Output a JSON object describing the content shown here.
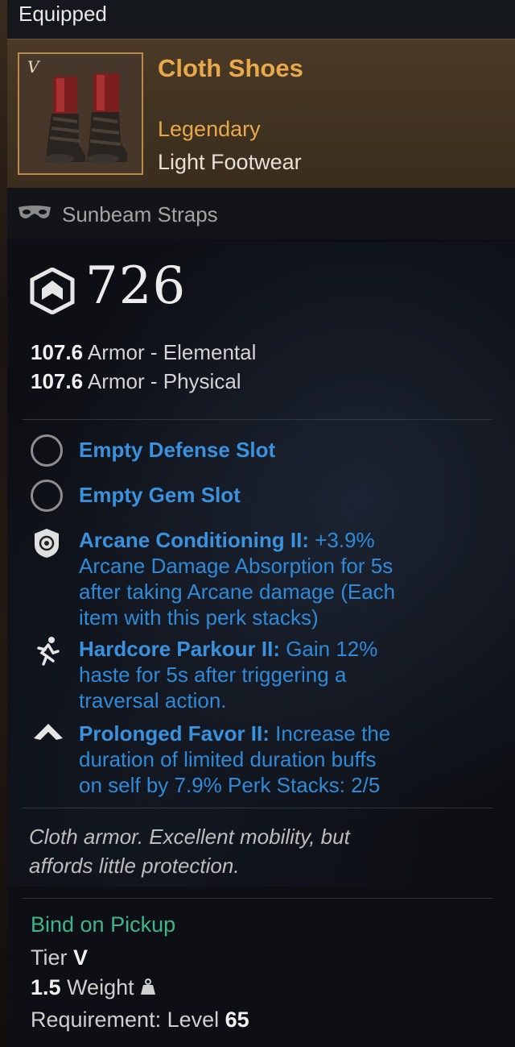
{
  "equipped_label": "Equipped",
  "item": {
    "name": "Cloth Shoes",
    "tier_mark": "V",
    "rarity": "Legendary",
    "type": "Light Footwear"
  },
  "skin": {
    "name": "Sunbeam Straps",
    "icon": "mask-icon"
  },
  "gear_score": {
    "value": "726",
    "icon": "gear-score-icon"
  },
  "armor": [
    {
      "value": "107.6",
      "label": "Armor - Elemental"
    },
    {
      "value": "107.6",
      "label": "Armor - Physical"
    }
  ],
  "slots": [
    {
      "label": "Empty Defense Slot",
      "icon": "empty-slot-icon"
    },
    {
      "label": "Empty Gem Slot",
      "icon": "empty-slot-icon"
    }
  ],
  "perks": [
    {
      "name": "Arcane Conditioning II:",
      "icon": "shield-perk-icon",
      "lines": [
        " +3.9%",
        "Arcane Damage Absorption for 5s",
        "after taking Arcane damage (Each",
        "item with this perk stacks)"
      ]
    },
    {
      "name": "Hardcore Parkour II:",
      "icon": "running-figure-icon",
      "lines": [
        " Gain 12%",
        "haste for 5s after triggering a",
        "traversal action."
      ]
    },
    {
      "name": "Prolonged Favor II:",
      "icon": "chevron-up-icon",
      "lines": [
        " Increase the",
        "duration of limited duration buffs",
        "on self by 7.9% Perk Stacks: 2/5"
      ]
    }
  ],
  "flavor_lines": [
    "Cloth armor. Excellent mobility, but",
    "affords little protection."
  ],
  "bind": "Bind on Pickup",
  "tier_label": "Tier",
  "tier_value": "V",
  "weight_value": "1.5",
  "weight_label": "Weight",
  "requirement_label": "Requirement: Level",
  "requirement_level": "65",
  "colors": {
    "legendary": "#e9a94b",
    "perk_blue": "#2f8ad8",
    "bind_green": "#3fb58a"
  }
}
